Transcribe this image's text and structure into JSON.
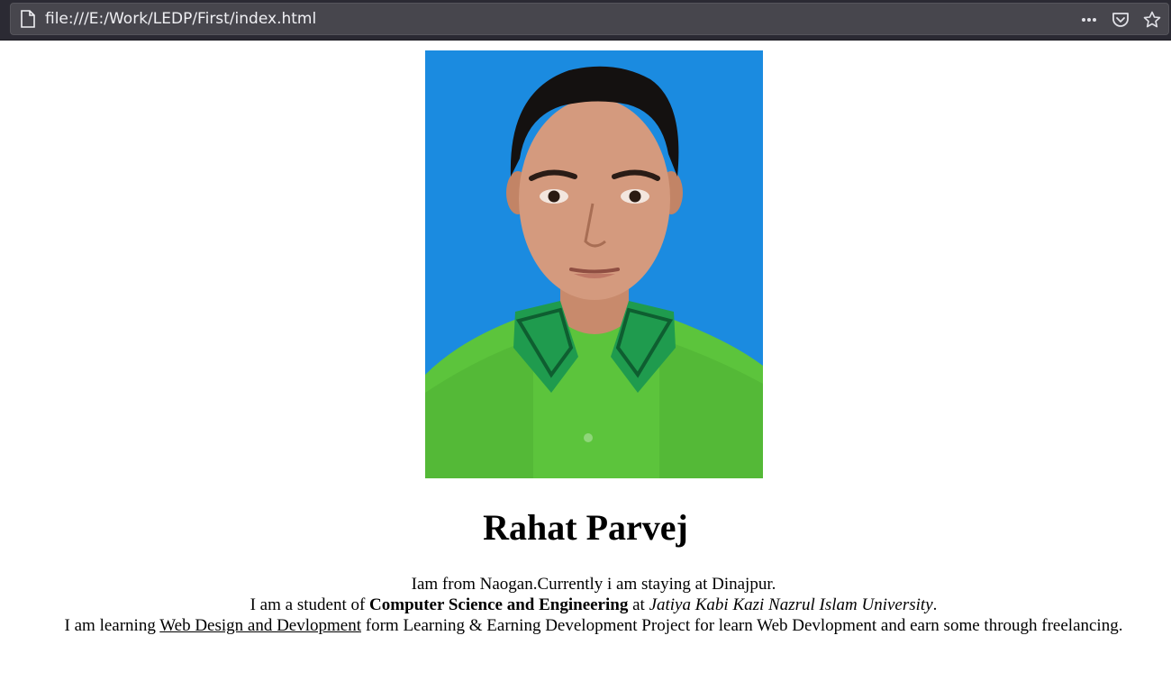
{
  "browser": {
    "url": "file:///E:/Work/LEDP/First/index.html",
    "icons": [
      "page-icon",
      "more-icon",
      "pocket-icon",
      "star-icon"
    ]
  },
  "profile": {
    "photo_alt": "Portrait photo",
    "name": "Rahat Parvej",
    "line1": "Iam from Naogan.Currently i am staying at Dinajpur.",
    "line2_prefix": "I am a student of ",
    "line2_bold": "Computer Science and Engineering",
    "line2_mid": " at ",
    "line2_italic": "Jatiya Kabi Kazi Nazrul Islam University",
    "line2_suffix": ".",
    "line3_prefix": "I am learning ",
    "line3_link": "Web Design and Devlopment",
    "line3_suffix": " form Learning & Earning Development Project for learn Web Devlopment and earn some through freelancing."
  },
  "colors": {
    "toolbar_bg": "#2b2a33",
    "urlbar_bg": "#47464d",
    "photo_bg": "#1b8be0",
    "shirt": "#5cc43c"
  }
}
